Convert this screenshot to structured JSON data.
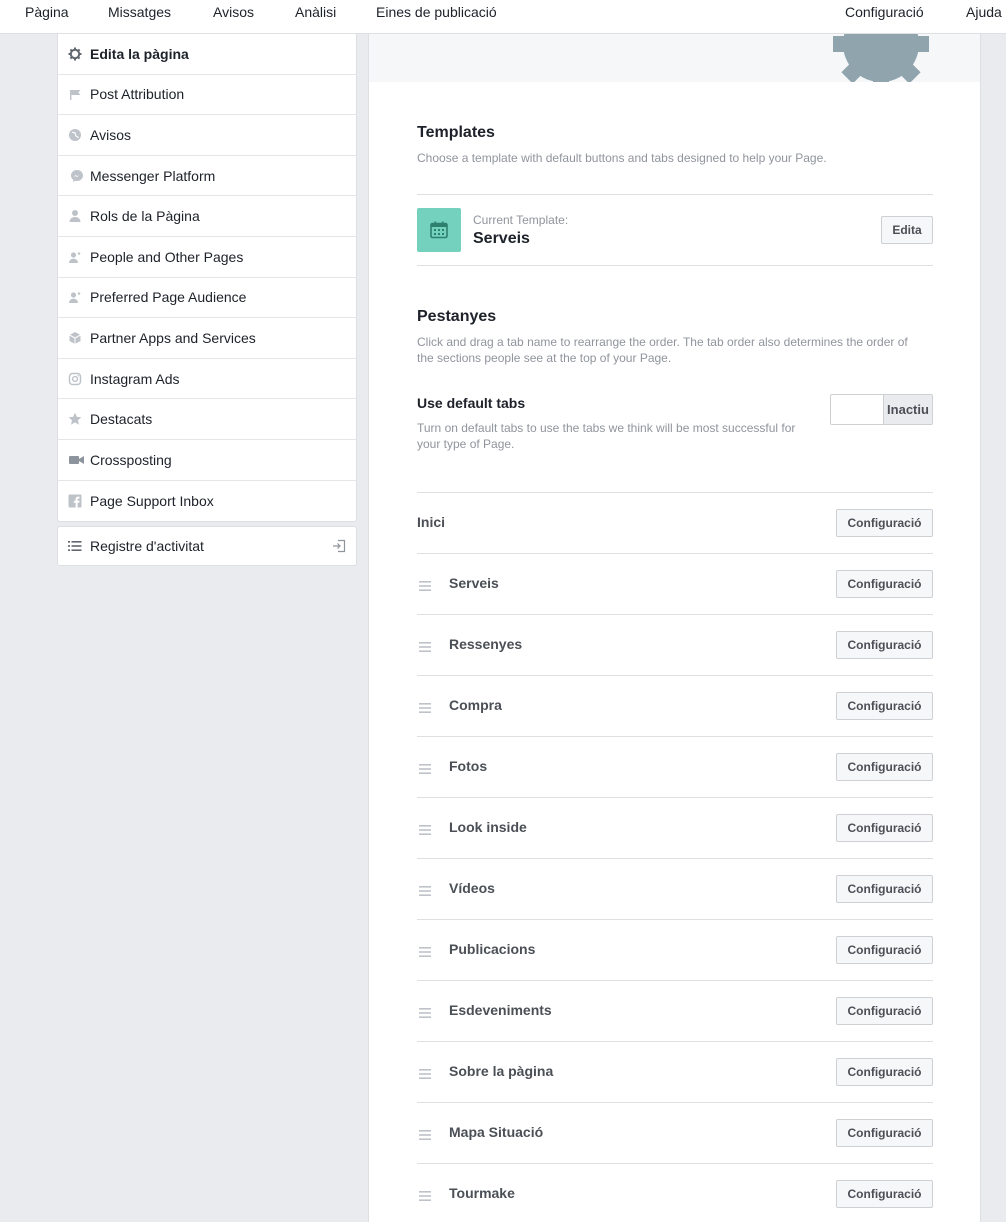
{
  "topnav": {
    "left": [
      "Pàgina",
      "Missatges",
      "Avisos",
      "Anàlisi",
      "Eines de publicació"
    ],
    "right": [
      "Configuració",
      "Ajuda"
    ]
  },
  "sidebar": {
    "items": [
      {
        "label": "Edita la pàgina",
        "icon": "gear-icon",
        "active": true
      },
      {
        "label": "Post Attribution",
        "icon": "flag-icon"
      },
      {
        "label": "Avisos",
        "icon": "globe-icon"
      },
      {
        "label": "Messenger Platform",
        "icon": "messenger-icon"
      },
      {
        "label": "Rols de la Pàgina",
        "icon": "person-icon"
      },
      {
        "label": "People and Other Pages",
        "icon": "person-star-icon"
      },
      {
        "label": "Preferred Page Audience",
        "icon": "person-star-icon"
      },
      {
        "label": "Partner Apps and Services",
        "icon": "cube-icon"
      },
      {
        "label": "Instagram Ads",
        "icon": "instagram-icon"
      },
      {
        "label": "Destacats",
        "icon": "star-icon"
      },
      {
        "label": "Crossposting",
        "icon": "video-camera-icon"
      },
      {
        "label": "Page Support Inbox",
        "icon": "facebook-icon"
      }
    ],
    "activity_log": {
      "label": "Registre d'activitat",
      "icon": "list-icon",
      "right_icon": "sign-in-icon"
    }
  },
  "templates": {
    "title": "Templates",
    "description": "Choose a template with default buttons and tabs designed to help your Page.",
    "current_caption": "Current Template:",
    "current_name": "Serveis",
    "edit_label": "Edita",
    "icon_color": "#74d1bd"
  },
  "tabs_section": {
    "title": "Pestanyes",
    "description_line1": "Click and drag a tab name to rearrange the order. The tab order also determines the order of",
    "description_line2": "the sections people see at the top of your Page.",
    "default_tabs": {
      "title": "Use default tabs",
      "description_line1": "Turn on default tabs to use the tabs we think will be most successful for",
      "description_line2": "your type of Page.",
      "toggle_label": "Inactiu",
      "enabled": false
    },
    "settings_label": "Configuració",
    "tabs": [
      {
        "name": "Inici",
        "draggable": false
      },
      {
        "name": "Serveis",
        "draggable": true
      },
      {
        "name": "Ressenyes",
        "draggable": true
      },
      {
        "name": "Compra",
        "draggable": true
      },
      {
        "name": "Fotos",
        "draggable": true
      },
      {
        "name": "Look inside",
        "draggable": true
      },
      {
        "name": "Vídeos",
        "draggable": true
      },
      {
        "name": "Publicacions",
        "draggable": true
      },
      {
        "name": "Esdeveniments",
        "draggable": true
      },
      {
        "name": "Sobre la pàgina",
        "draggable": true
      },
      {
        "name": "Mapa Situació",
        "draggable": true
      },
      {
        "name": "Tourmake",
        "draggable": true
      }
    ]
  }
}
